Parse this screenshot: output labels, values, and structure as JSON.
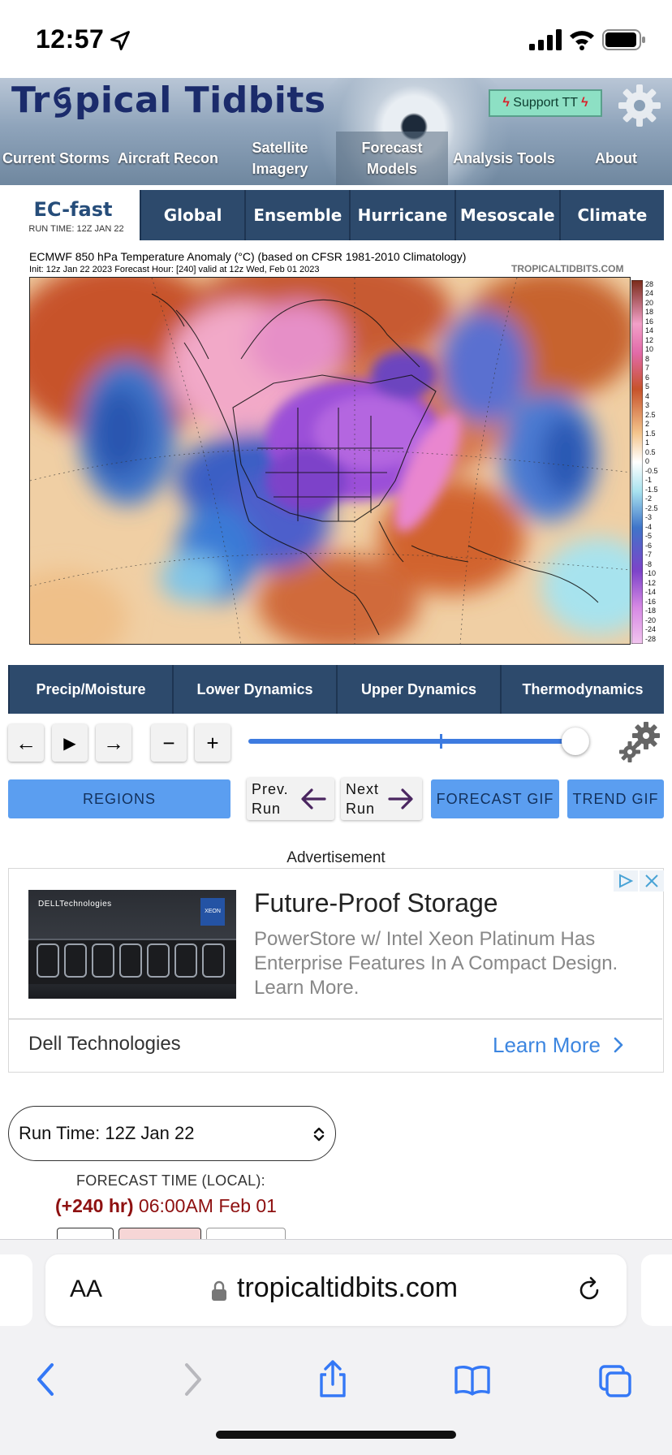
{
  "status_bar": {
    "time": "12:57"
  },
  "header": {
    "logo_part1": "Tr",
    "logo_part2": "pical Tidbits",
    "support_label": "Support TT",
    "nav": [
      {
        "label": "Current Storms"
      },
      {
        "label": "Aircraft Recon"
      },
      {
        "label": "Satellite Imagery"
      },
      {
        "label": "Forecast Models",
        "active": true
      },
      {
        "label": "Analysis Tools"
      },
      {
        "label": "About"
      }
    ]
  },
  "model": {
    "name": "EC-fast",
    "run_time": "RUN TIME: 12Z JAN 22",
    "tabs": [
      "Global",
      "Ensemble",
      "Hurricane",
      "Mesoscale",
      "Climate"
    ]
  },
  "map": {
    "title": "ECMWF 850 hPa Temperature Anomaly (°C) (based on CFSR 1981-2010 Climatology)",
    "subtitle": "Init: 12z Jan 22 2023   Forecast Hour: [240]   valid at 12z Wed, Feb 01 2023",
    "watermark": "TROPICALTIDBITS.COM",
    "colorbar_labels": [
      "28",
      "24",
      "20",
      "18",
      "16",
      "14",
      "12",
      "10",
      "8",
      "7",
      "6",
      "5",
      "4",
      "3",
      "2.5",
      "2",
      "1.5",
      "1",
      "0.5",
      "0",
      "-0.5",
      "-1",
      "-1.5",
      "-2",
      "-2.5",
      "-3",
      "-4",
      "-5",
      "-6",
      "-7",
      "-8",
      "-10",
      "-12",
      "-14",
      "-16",
      "-18",
      "-20",
      "-24",
      "-28"
    ]
  },
  "param_tabs": [
    "Precip/Moisture",
    "Lower Dynamics",
    "Upper Dynamics",
    "Thermodynamics"
  ],
  "controls": {
    "back": "←",
    "play": "▶",
    "forward": "→",
    "minus": "−",
    "plus": "+",
    "slider_fraction": 0.96,
    "regions_label": "REGIONS",
    "prev_run_line1": "Prev.",
    "prev_run_line2": "Run",
    "next_run_line1": "Next",
    "next_run_line2": "Run",
    "forecast_gif_label": "FORECAST GIF",
    "trend_gif_label": "TREND GIF"
  },
  "ad": {
    "label": "Advertisement",
    "image_brand": "DELLTechnologies",
    "image_chip": "XEON",
    "title": "Future-Proof Storage",
    "text": "PowerStore w/ Intel Xeon Platinum Has Enterprise Features In A Compact Design. Learn More.",
    "advertiser": "Dell Technologies",
    "cta": "Learn More"
  },
  "run_select": {
    "value": "Run Time: 12Z Jan 22"
  },
  "forecast_time": {
    "label": "FORECAST TIME (LOCAL):",
    "hour": "(+240 hr)",
    "date": "06:00AM Feb 01"
  },
  "browser": {
    "aa_label": "AA",
    "url": "tropicaltidbits.com"
  },
  "colors": {
    "nav_dark": "#2d4a6c",
    "button_blue": "#5b9ef0",
    "logo_blue": "#1b2b6b",
    "accent_red": "#8e1010",
    "link_blue": "#3d86e0"
  }
}
